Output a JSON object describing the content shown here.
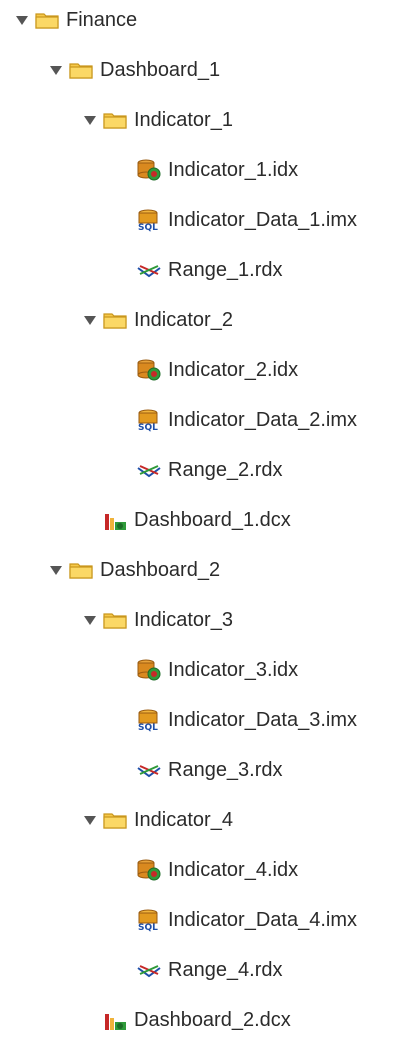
{
  "tree": {
    "finance": {
      "label": "Finance",
      "dashboard_1": {
        "label": "Dashboard_1",
        "indicator_1": {
          "label": "Indicator_1",
          "file_idx": "Indicator_1.idx",
          "file_imx": "Indicator_Data_1.imx",
          "file_rdx": "Range_1.rdx"
        },
        "indicator_2": {
          "label": "Indicator_2",
          "file_idx": "Indicator_2.idx",
          "file_imx": "Indicator_Data_2.imx",
          "file_rdx": "Range_2.rdx"
        },
        "dcx": "Dashboard_1.dcx"
      },
      "dashboard_2": {
        "label": "Dashboard_2",
        "indicator_3": {
          "label": "Indicator_3",
          "file_idx": "Indicator_3.idx",
          "file_imx": "Indicator_Data_3.imx",
          "file_rdx": "Range_3.rdx"
        },
        "indicator_4": {
          "label": "Indicator_4",
          "file_idx": "Indicator_4.idx",
          "file_imx": "Indicator_Data_4.imx",
          "file_rdx": "Range_4.rdx"
        },
        "dcx": "Dashboard_2.dcx"
      }
    }
  },
  "icons": {
    "folder": "folder-icon",
    "expand": "expand-triangle-icon",
    "indicator": "indicator-file-icon",
    "data": "sql-data-file-icon",
    "range": "range-file-icon",
    "dashboard": "dashboard-file-icon"
  },
  "colors": {
    "folder_fill": "#f6c94a",
    "folder_stroke": "#c9961c",
    "text": "#2b2b2b",
    "triangle": "#555555",
    "sql_blue": "#1f4fa8"
  }
}
